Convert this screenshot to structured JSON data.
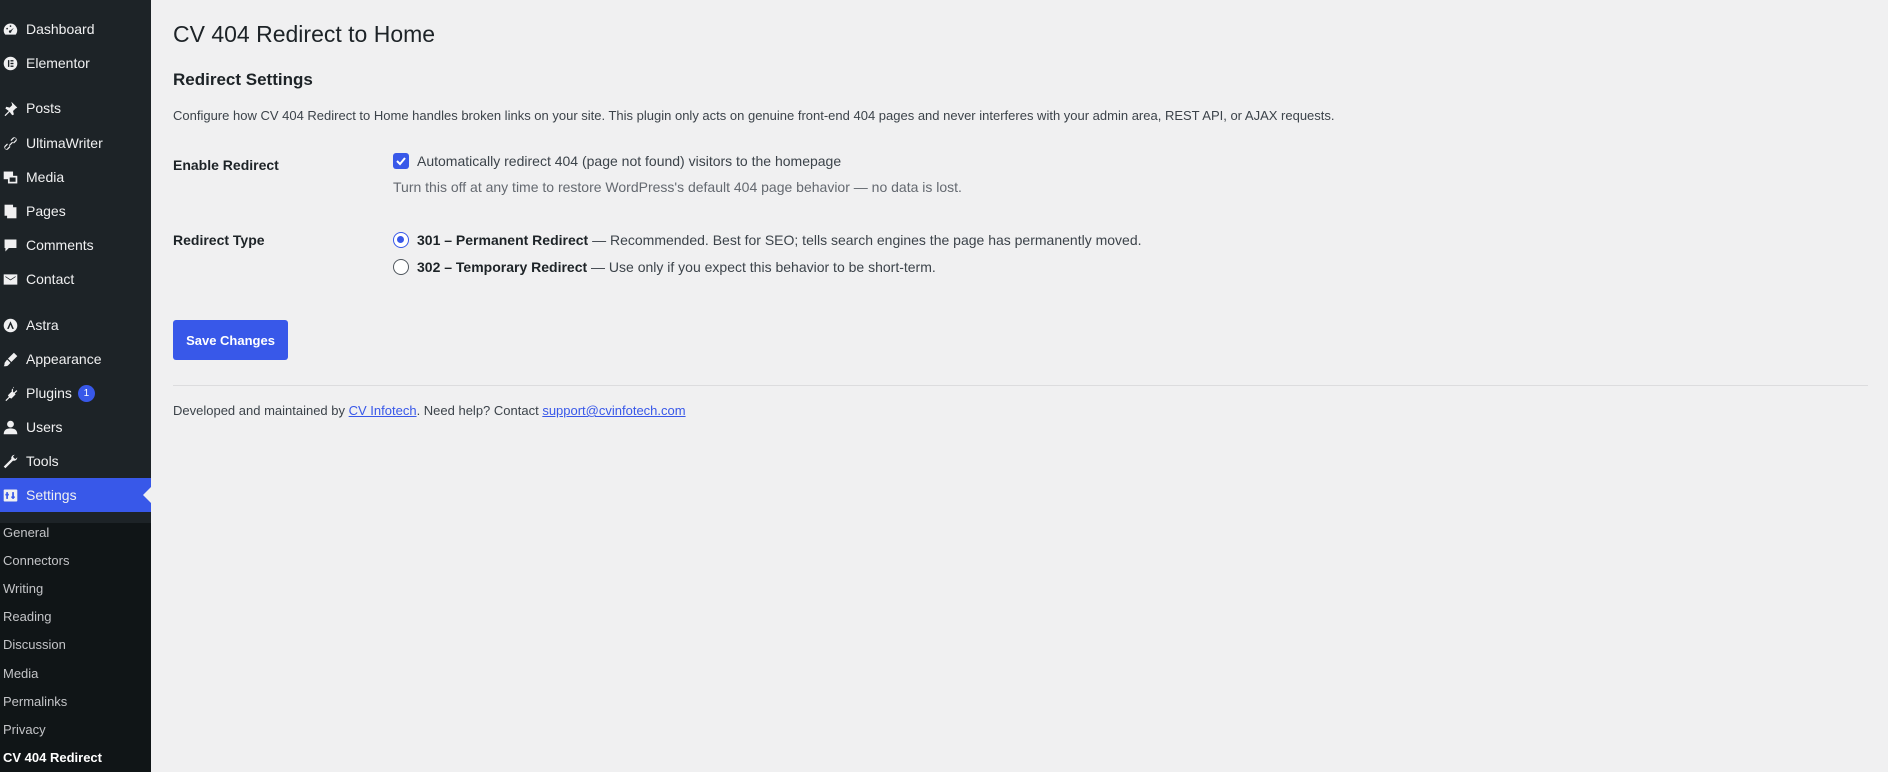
{
  "sidebar": {
    "items": [
      {
        "label": "Dashboard",
        "icon": "dashboard-icon"
      },
      {
        "label": "Elementor",
        "icon": "elementor-icon"
      },
      {
        "label": "Posts",
        "icon": "pin-icon"
      },
      {
        "label": "UltimaWriter",
        "icon": "link-icon"
      },
      {
        "label": "Media",
        "icon": "media-icon"
      },
      {
        "label": "Pages",
        "icon": "pages-icon"
      },
      {
        "label": "Comments",
        "icon": "comment-icon"
      },
      {
        "label": "Contact",
        "icon": "mail-icon"
      },
      {
        "label": "Astra",
        "icon": "astra-icon"
      },
      {
        "label": "Appearance",
        "icon": "brush-icon"
      },
      {
        "label": "Plugins",
        "icon": "plugin-icon",
        "badge": "1"
      },
      {
        "label": "Users",
        "icon": "user-icon"
      },
      {
        "label": "Tools",
        "icon": "wrench-icon"
      },
      {
        "label": "Settings",
        "icon": "settings-icon",
        "active": true
      }
    ],
    "submenu": [
      "General",
      "Connectors",
      "Writing",
      "Reading",
      "Discussion",
      "Media",
      "Permalinks",
      "Privacy",
      "CV 404 Redirect"
    ]
  },
  "page": {
    "title": "CV 404 Redirect to Home",
    "section_title": "Redirect Settings",
    "intro": "Configure how CV 404 Redirect to Home handles broken links on your site. This plugin only acts on genuine front-end 404 pages and never interferes with your admin area, REST API, or AJAX requests."
  },
  "enable_redirect": {
    "label": "Enable Redirect",
    "checkbox_label": "Automatically redirect 404 (page not found) visitors to the homepage",
    "checked": true,
    "description": "Turn this off at any time to restore WordPress's default 404 page behavior — no data is lost."
  },
  "redirect_type": {
    "label": "Redirect Type",
    "options": [
      {
        "strong": "301 – Permanent Redirect",
        "rest": " — Recommended. Best for SEO; tells search engines the page has permanently moved.",
        "checked": true
      },
      {
        "strong": "302 – Temporary Redirect",
        "rest": " — Use only if you expect this behavior to be short-term.",
        "checked": false
      }
    ]
  },
  "save_label": "Save Changes",
  "footer": {
    "prefix": "Developed and maintained by ",
    "company": "CV Infotech",
    "middle": ". Need help? Contact ",
    "email": "support@cvinfotech.com"
  },
  "colors": {
    "accent": "#3858e9",
    "sidebar_bg": "#1d2327",
    "page_bg": "#f0f0f1"
  }
}
